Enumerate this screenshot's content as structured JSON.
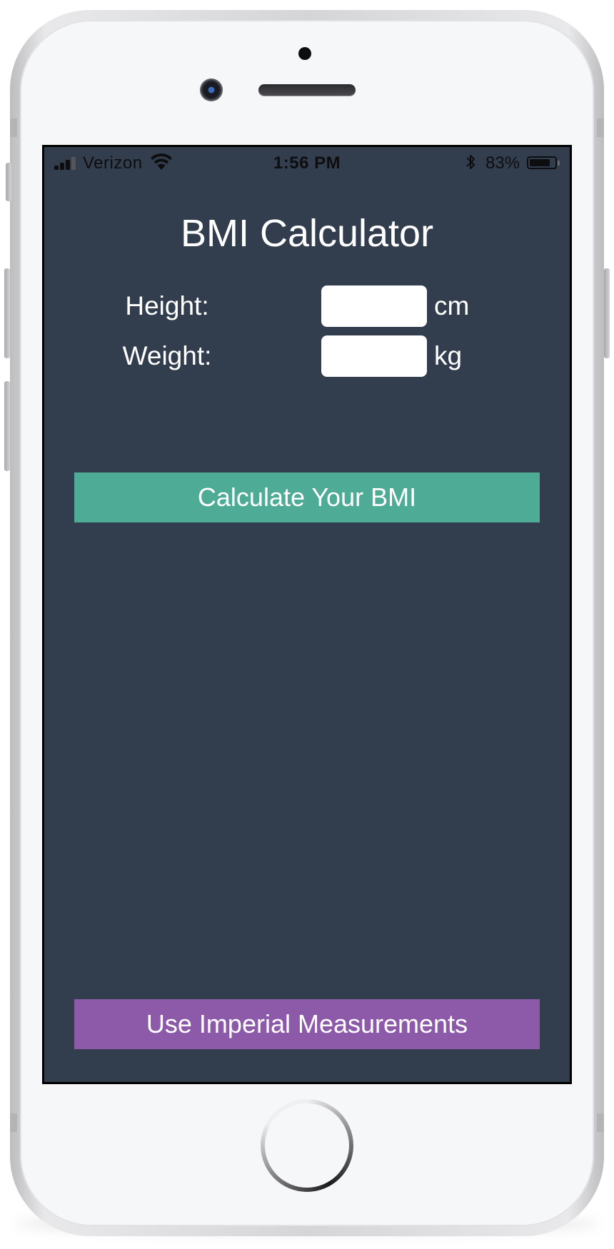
{
  "status_bar": {
    "carrier": "Verizon",
    "time": "1:56 PM",
    "battery_percent": "83%",
    "battery_level": 0.83,
    "icons": [
      "signal-bars-icon",
      "wifi-icon",
      "bluetooth-icon",
      "battery-icon"
    ]
  },
  "app": {
    "title": "BMI Calculator",
    "background_color": "#323e4e"
  },
  "form": {
    "height_label": "Height:",
    "height_value": "",
    "height_unit": "cm",
    "weight_label": "Weight:",
    "weight_value": "",
    "weight_unit": "kg"
  },
  "buttons": {
    "calculate_label": "Calculate Your BMI",
    "calculate_color": "#4dab96",
    "imperial_label": "Use Imperial Measurements",
    "imperial_color": "#8c5aa9"
  }
}
